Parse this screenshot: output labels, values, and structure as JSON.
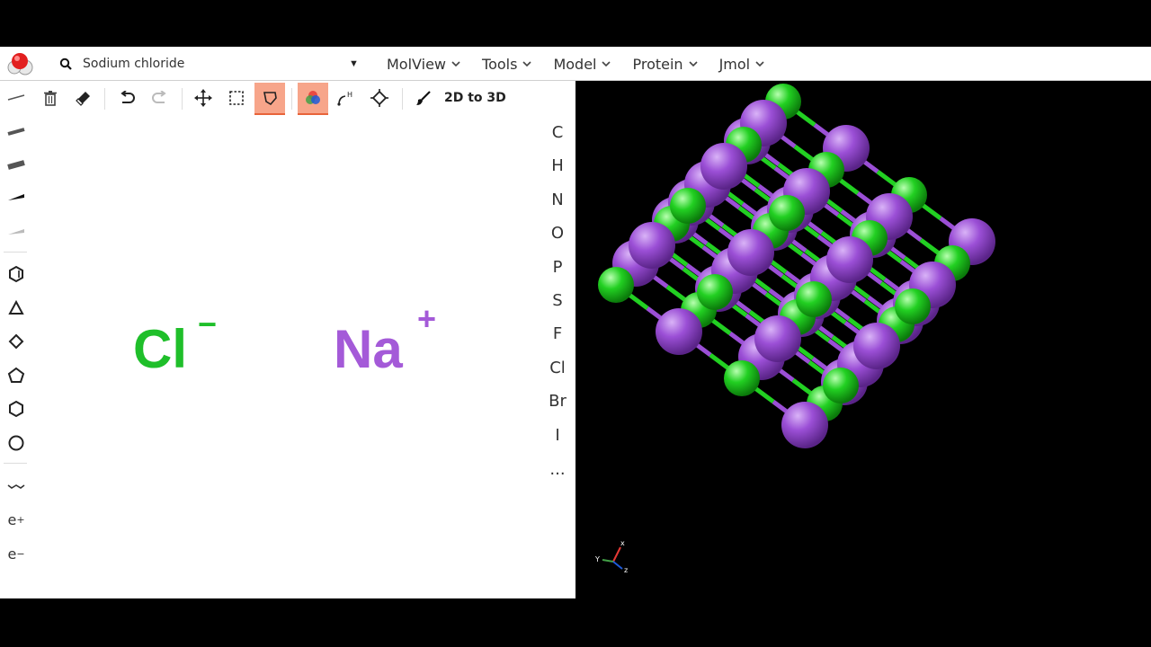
{
  "search": {
    "value": "Sodium chloride",
    "placeholder": ""
  },
  "menus": [
    "MolView",
    "Tools",
    "Model",
    "Protein",
    "Jmol"
  ],
  "toolbar": {
    "to3d_label": "2D to 3D"
  },
  "elements": [
    "C",
    "H",
    "N",
    "O",
    "P",
    "S",
    "F",
    "Cl",
    "Br",
    "I",
    "..."
  ],
  "left_tools": {
    "electron_plus": "e",
    "electron_minus": "e",
    "plus_sign": "+",
    "minus_sign": "−"
  },
  "canvas": {
    "chloride": {
      "symbol": "Cl",
      "charge": "−",
      "color": "#1fbf2a"
    },
    "sodium": {
      "symbol": "Na",
      "charge": "+",
      "color": "#a45ad8"
    }
  },
  "viewer": {
    "axes": {
      "x": "x",
      "y": "Y",
      "z": "z"
    },
    "colors": {
      "sodium": "#9b4fd6",
      "chlorine": "#22d022",
      "background": "#000000"
    }
  },
  "colors": {
    "active_tool": "#f7a58a",
    "accent": "#e8643a"
  }
}
